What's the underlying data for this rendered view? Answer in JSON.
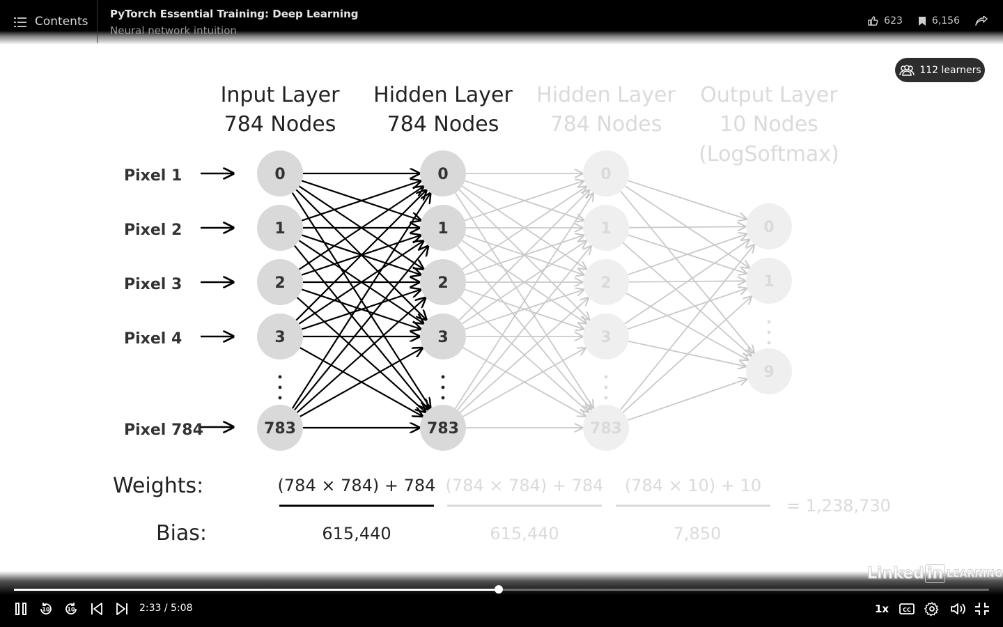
{
  "header": {
    "contents_label": "Contents",
    "course_title": "PyTorch Essential Training: Deep Learning",
    "video_title": "Neural network intuition",
    "likes": "623",
    "saves": "6,156"
  },
  "learners_badge": "112 learners",
  "slide": {
    "layers": [
      {
        "title": "Input Layer",
        "sub": "784 Nodes",
        "sub2": "",
        "nodes": [
          "0",
          "1",
          "2",
          "3",
          "783"
        ]
      },
      {
        "title": "Hidden Layer",
        "sub": "784 Nodes",
        "sub2": "",
        "nodes": [
          "0",
          "1",
          "2",
          "3",
          "783"
        ]
      },
      {
        "title": "Hidden Layer",
        "sub": "784 Nodes",
        "sub2": "",
        "nodes": [
          "0",
          "1",
          "2",
          "3",
          "783"
        ]
      },
      {
        "title": "Output Layer",
        "sub": "10 Nodes",
        "sub2": "(LogSoftmax)",
        "nodes": [
          "0",
          "1",
          "9"
        ]
      }
    ],
    "pixels": [
      "Pixel 1",
      "Pixel 2",
      "Pixel 3",
      "Pixel 4",
      "Pixel 784"
    ],
    "weights_label": "Weights:",
    "bias_label": "Bias:",
    "weight_exprs": [
      "(784 × 784) + 784",
      "(784 × 784) + 784",
      "(784 × 10) + 10"
    ],
    "param_counts": [
      "615,440",
      "615,440",
      "7,850"
    ],
    "total": "=  1,238,730"
  },
  "player": {
    "current_time": "2:33",
    "duration": "5:08",
    "time_display": "2:33 / 5:08",
    "progress_fraction": 0.4968,
    "speed": "1x",
    "skip_back_seconds": "10",
    "skip_forward_seconds": "10"
  },
  "watermark": {
    "part1": "Linked",
    "part2": "in",
    "part3": "LEARNING"
  },
  "colors": {
    "active": "#000000",
    "node_fill": "#d9d9d9",
    "faded_line": "#c9c9c9",
    "faded_node": "#efefef",
    "faded_text": "#dadada"
  }
}
